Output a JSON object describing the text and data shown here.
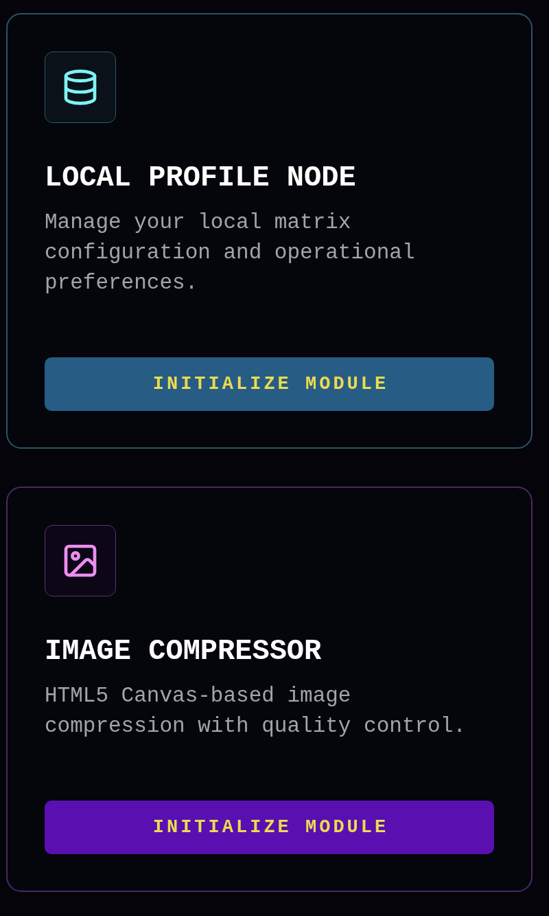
{
  "modules": [
    {
      "kind": "storage",
      "color": "#275c84",
      "title": "LOCAL PROFILE NODE",
      "description": "Manage your local matrix configuration and operational preferences.",
      "button_label": "INITIALIZE MODULE"
    },
    {
      "kind": "media",
      "color": "#5a10b0",
      "title": "IMAGE COMPRESSOR",
      "description": "HTML5 Canvas-based image compression with quality control.",
      "button_label": "INITIALIZE MODULE"
    }
  ]
}
